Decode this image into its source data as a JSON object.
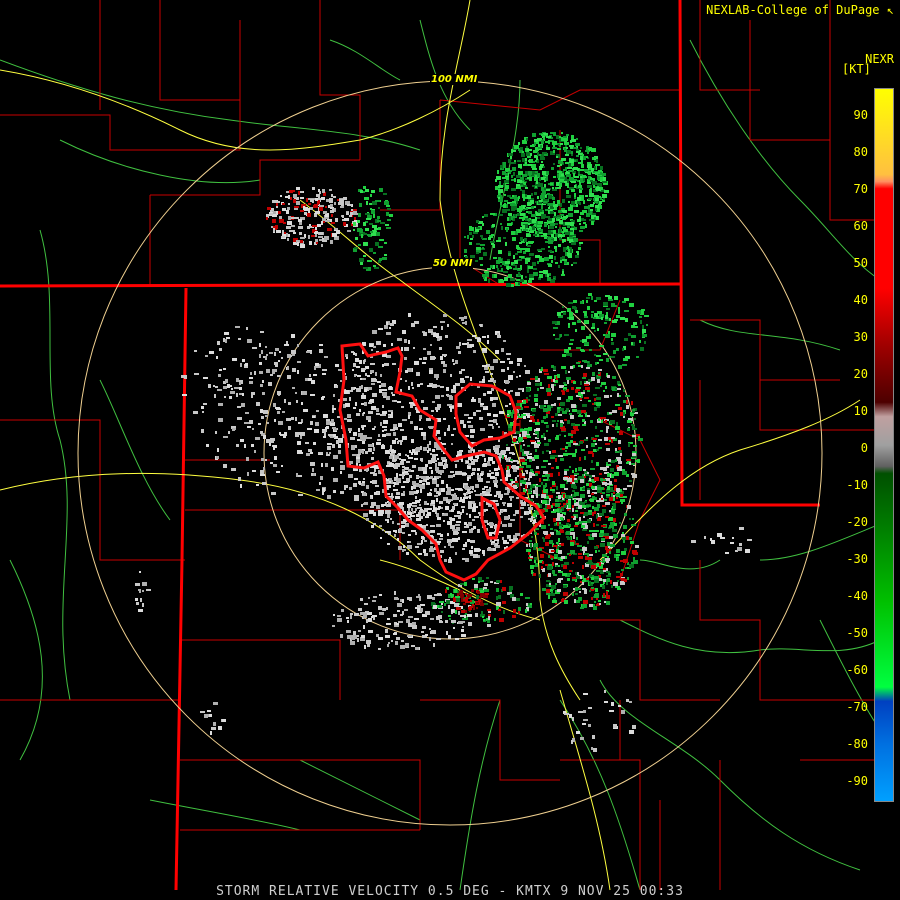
{
  "credit": "NEXLAB-College of DuPage",
  "credit_icon": "cursor-arrow-icon",
  "product_code": "NEXR",
  "units": "[KT]",
  "footer": "STORM RELATIVE VELOCITY 0.5 DEG - KMTX 9 NOV 25 00:33",
  "rings": [
    {
      "label": "100 NMI"
    },
    {
      "label": "50 NMI"
    }
  ],
  "legend": {
    "ticks": [
      "90",
      "80",
      "70",
      "60",
      "50",
      "40",
      "30",
      "20",
      "10",
      "0",
      "-10",
      "-20",
      "-30",
      "-40",
      "-50",
      "-60",
      "-70",
      "-80",
      "-90"
    ],
    "colors": {
      "max": "#ffff00",
      "high": "#ff0000",
      "mid_red": "#a00000",
      "dark_red": "#4d0000",
      "zero": "#a0a0a0",
      "dark_green": "#005000",
      "green": "#00c000",
      "bright_green": "#00ff40",
      "blue": "#0040c0",
      "light_blue": "#00a0ff"
    }
  },
  "colors": {
    "state_border": "#ff0000",
    "county_line": "#c80000",
    "highway": "#ffff40",
    "road": "#40c040",
    "range_ring": "#f0d090",
    "warning_polygon": "#ff1010",
    "inbound": "#20d040",
    "outbound": "#c00000",
    "near_zero": "#c8c8c8"
  }
}
